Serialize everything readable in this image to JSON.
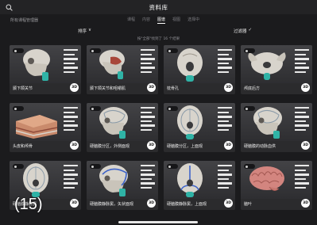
{
  "header": {
    "title": "资料库"
  },
  "nav": {
    "left_label": "所有课程管理器",
    "tabs": [
      {
        "label": "课程"
      },
      {
        "label": "内容"
      },
      {
        "label": "图谱"
      },
      {
        "label": "视图"
      },
      {
        "label": "选择中"
      }
    ],
    "active_tab": "图谱"
  },
  "toolbar": {
    "sort_label": "排序",
    "filter_label": "过滤器"
  },
  "results_text": "按\"全部\"找到了 16 个结果",
  "cards": [
    {
      "label": "颞下颌关节",
      "thumb": "skull-lateral-icon",
      "badge": "3D"
    },
    {
      "label": "颞下颌关节和咀嚼肌",
      "thumb": "skull-jaw-muscle-icon",
      "badge": "3D"
    },
    {
      "label": "枕骨孔",
      "thumb": "skull-base-icon",
      "badge": "3D"
    },
    {
      "label": "颅底后方",
      "thumb": "skull-top-icon",
      "badge": "3D"
    },
    {
      "label": "头皮和颅骨",
      "thumb": "scalp-layers-icon",
      "badge": "3D"
    },
    {
      "label": "硬脑膜分区，外侧面观",
      "thumb": "skull-dura-lateral-icon",
      "badge": "3D"
    },
    {
      "label": "硬脑膜分区，上面观",
      "thumb": "skull-dura-superior-icon",
      "badge": "3D"
    },
    {
      "label": "硬脑膜的动脉血供",
      "thumb": "skull-dura-lateral-icon",
      "badge": "3D"
    },
    {
      "label": "硬脑膜静脉窦",
      "thumb": "skull-dura-superior-icon",
      "badge": "3D"
    },
    {
      "label": "硬脑膜静脉窦，矢状面观",
      "thumb": "skull-sinus-sagittal-icon",
      "badge": "3D"
    },
    {
      "label": "硬脑膜静脉窦，上面观",
      "thumb": "skull-sinus-superior-icon",
      "badge": "3D"
    },
    {
      "label": "脑叶",
      "thumb": "brain-icon",
      "badge": "3D"
    }
  ],
  "overlay_count": "(15)",
  "colors": {
    "background": "#1b1b1d",
    "card": "#2b2b2d",
    "accent": "#2fb3a6",
    "bone": "#d8d4cc"
  }
}
